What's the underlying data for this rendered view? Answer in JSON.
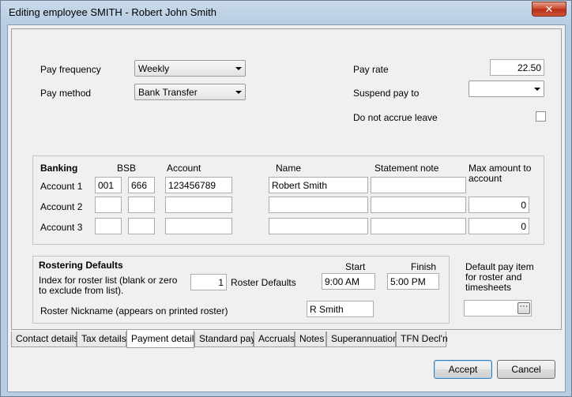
{
  "window": {
    "title": "Editing employee SMITH - Robert John Smith",
    "close_glyph": "✕"
  },
  "pay": {
    "frequency_label": "Pay frequency",
    "frequency_value": "Weekly",
    "method_label": "Pay method",
    "method_value": "Bank Transfer",
    "rate_label": "Pay rate",
    "rate_value": "22.50",
    "suspend_label": "Suspend pay to",
    "suspend_value": "",
    "no_accrue_label": "Do not accrue leave"
  },
  "banking": {
    "title": "Banking",
    "headers": {
      "bsb": "BSB",
      "account": "Account",
      "name": "Name",
      "statement": "Statement note",
      "max_amount": "Max amount to account"
    },
    "rows": [
      {
        "label": "Account 1",
        "bsb1": "001",
        "bsb2": "666",
        "account": "123456789",
        "name": "Robert Smith",
        "statement": "",
        "max": ""
      },
      {
        "label": "Account 2",
        "bsb1": "",
        "bsb2": "",
        "account": "",
        "name": "",
        "statement": "",
        "max": "0"
      },
      {
        "label": "Account 3",
        "bsb1": "",
        "bsb2": "",
        "account": "",
        "name": "",
        "statement": "",
        "max": "0"
      }
    ]
  },
  "roster": {
    "title": "Rostering Defaults",
    "index_label": "Index for roster list (blank or zero to exclude from list).",
    "index_value": "1",
    "defaults_label": "Roster Defaults",
    "start_label": "Start",
    "start_value": "9:00 AM",
    "finish_label": "Finish",
    "finish_value": "5:00 PM",
    "nickname_label": "Roster Nickname (appears on printed roster)",
    "nickname_value": "R Smith",
    "default_pay_label": "Default pay item for roster and timesheets",
    "default_pay_value": "",
    "ellipsis": "···"
  },
  "tabs": [
    {
      "label": "Contact details"
    },
    {
      "label": "Tax details"
    },
    {
      "label": "Payment details"
    },
    {
      "label": "Standard pay"
    },
    {
      "label": "Accruals"
    },
    {
      "label": "Notes"
    },
    {
      "label": "Superannuation"
    },
    {
      "label": "TFN Decl'n"
    }
  ],
  "buttons": {
    "accept": "Accept",
    "cancel": "Cancel"
  }
}
